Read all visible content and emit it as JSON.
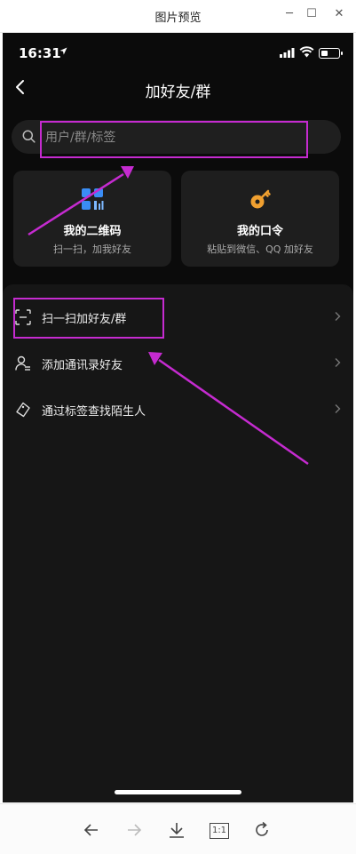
{
  "window": {
    "title": "图片预览",
    "controls": [
      "minimize-icon",
      "maximize-icon",
      "close-icon"
    ]
  },
  "status_bar": {
    "time": "16:31"
  },
  "nav": {
    "title": "加好友/群"
  },
  "search": {
    "placeholder": "用户/群/标签"
  },
  "cards": [
    {
      "title": "我的二维码",
      "subtitle": "扫一扫，加我好友",
      "icon": "qr-code-icon"
    },
    {
      "title": "我的口令",
      "subtitle": "粘贴到微信、QQ 加好友",
      "icon": "key-icon"
    }
  ],
  "menu": [
    {
      "label": "扫一扫加好友/群",
      "icon": "scan-icon"
    },
    {
      "label": "添加通讯录好友",
      "icon": "contacts-icon"
    },
    {
      "label": "通过标签查找陌生人",
      "icon": "tag-icon"
    }
  ],
  "toolbar": {
    "items": [
      "back-arrow-icon",
      "forward-arrow-icon",
      "download-icon",
      "actual-size-icon",
      "rotate-icon"
    ],
    "actual_size_label": "1:1"
  },
  "colors": {
    "background": "#0b0b0b",
    "panel": "#161616",
    "card": "#1e1e1e",
    "annotation": "#c52bd0",
    "qr_blue": "#3a8df5",
    "key_orange": "#f0a030"
  }
}
